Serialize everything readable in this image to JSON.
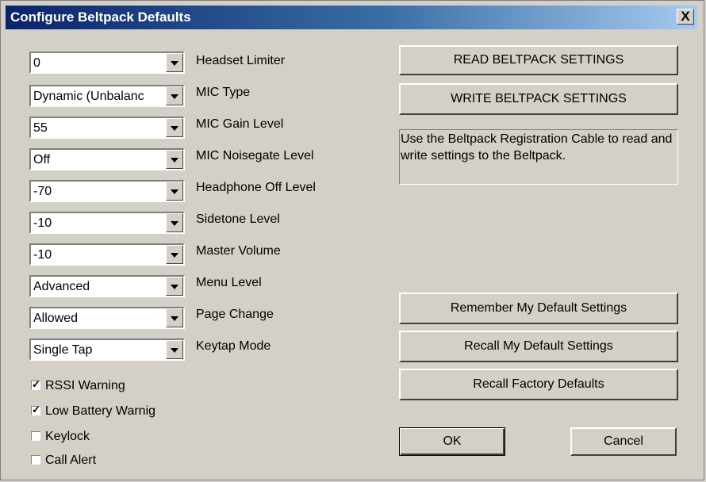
{
  "window": {
    "title": "Configure Beltpack Defaults",
    "close_label": "X"
  },
  "settings": [
    {
      "value": "0",
      "label": "Headset Limiter"
    },
    {
      "value": "Dynamic (Unbalanc",
      "label": "MIC Type"
    },
    {
      "value": "55",
      "label": "MIC Gain Level"
    },
    {
      "value": "Off",
      "label": "MIC Noisegate Level"
    },
    {
      "value": "-70",
      "label": "Headphone Off Level"
    },
    {
      "value": "-10",
      "label": "Sidetone Level"
    },
    {
      "value": "-10",
      "label": "Master Volume"
    },
    {
      "value": "Advanced",
      "label": "Menu Level"
    },
    {
      "value": "Allowed",
      "label": "Page Change"
    },
    {
      "value": "Single Tap",
      "label": "Keytap Mode"
    }
  ],
  "checkboxes": [
    {
      "label": "RSSI Warning",
      "checked": true
    },
    {
      "label": "Low Battery Warnig",
      "checked": true
    },
    {
      "label": "Keylock",
      "checked": false
    },
    {
      "label": "Call Alert",
      "checked": false
    }
  ],
  "buttons": {
    "read": "READ BELTPACK SETTINGS",
    "write": "WRITE BELTPACK SETTINGS",
    "remember": "Remember My Default Settings",
    "recall": "Recall My Default Settings",
    "factory": "Recall Factory Defaults",
    "ok": "OK",
    "cancel": "Cancel"
  },
  "info_text": "Use the Beltpack Registration Cable to read and write settings to the Beltpack."
}
